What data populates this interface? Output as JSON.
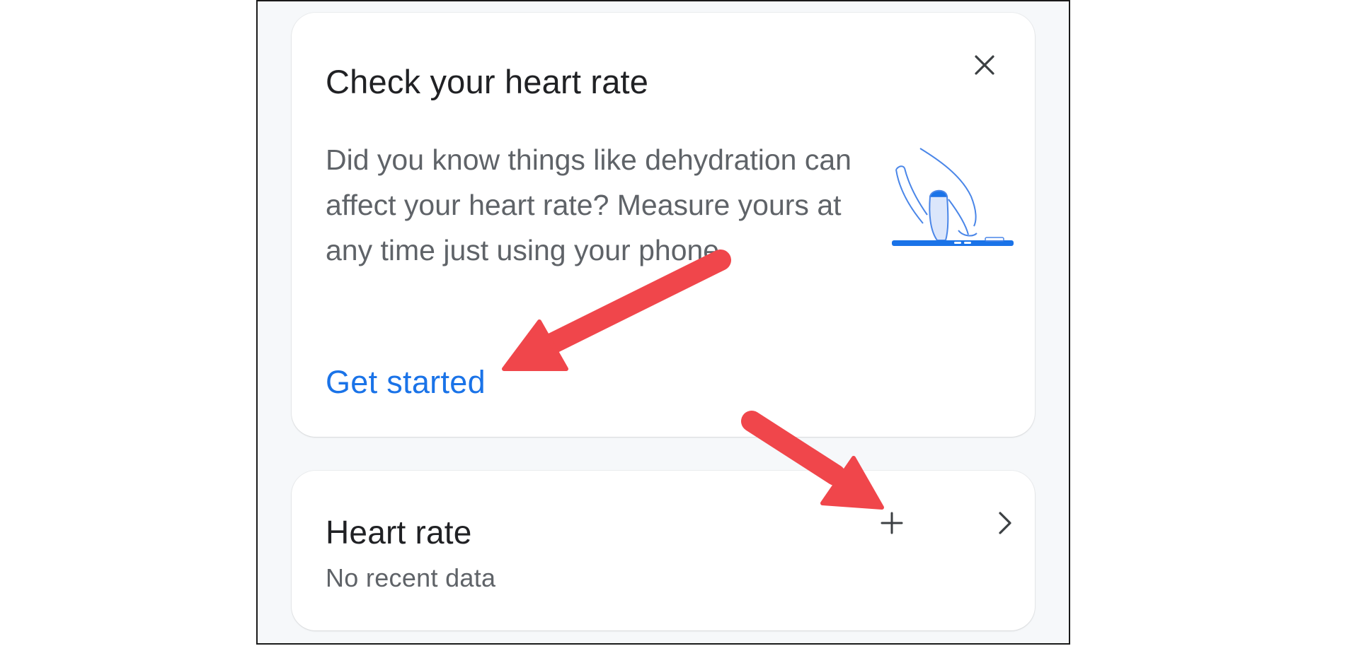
{
  "intro_card": {
    "title": "Check your heart rate",
    "body": "Did you know things like dehydration can affect your heart rate? Measure yours at any time just using your phone.",
    "cta_label": "Get started",
    "close_icon": "close-icon",
    "illustration": "finger-on-phone-camera-illustration"
  },
  "heart_rate_card": {
    "title": "Heart rate",
    "subtitle": "No recent data",
    "add_icon": "plus-icon",
    "open_icon": "chevron-right-icon"
  },
  "annotations": {
    "arrow_color": "#f0464b",
    "arrows": [
      "arrow-to-get-started",
      "arrow-to-plus"
    ]
  },
  "colors": {
    "accent": "#1a73e8",
    "title": "#202124",
    "secondary_text": "#5f6368",
    "background": "#f6f8fa",
    "card": "#ffffff"
  }
}
